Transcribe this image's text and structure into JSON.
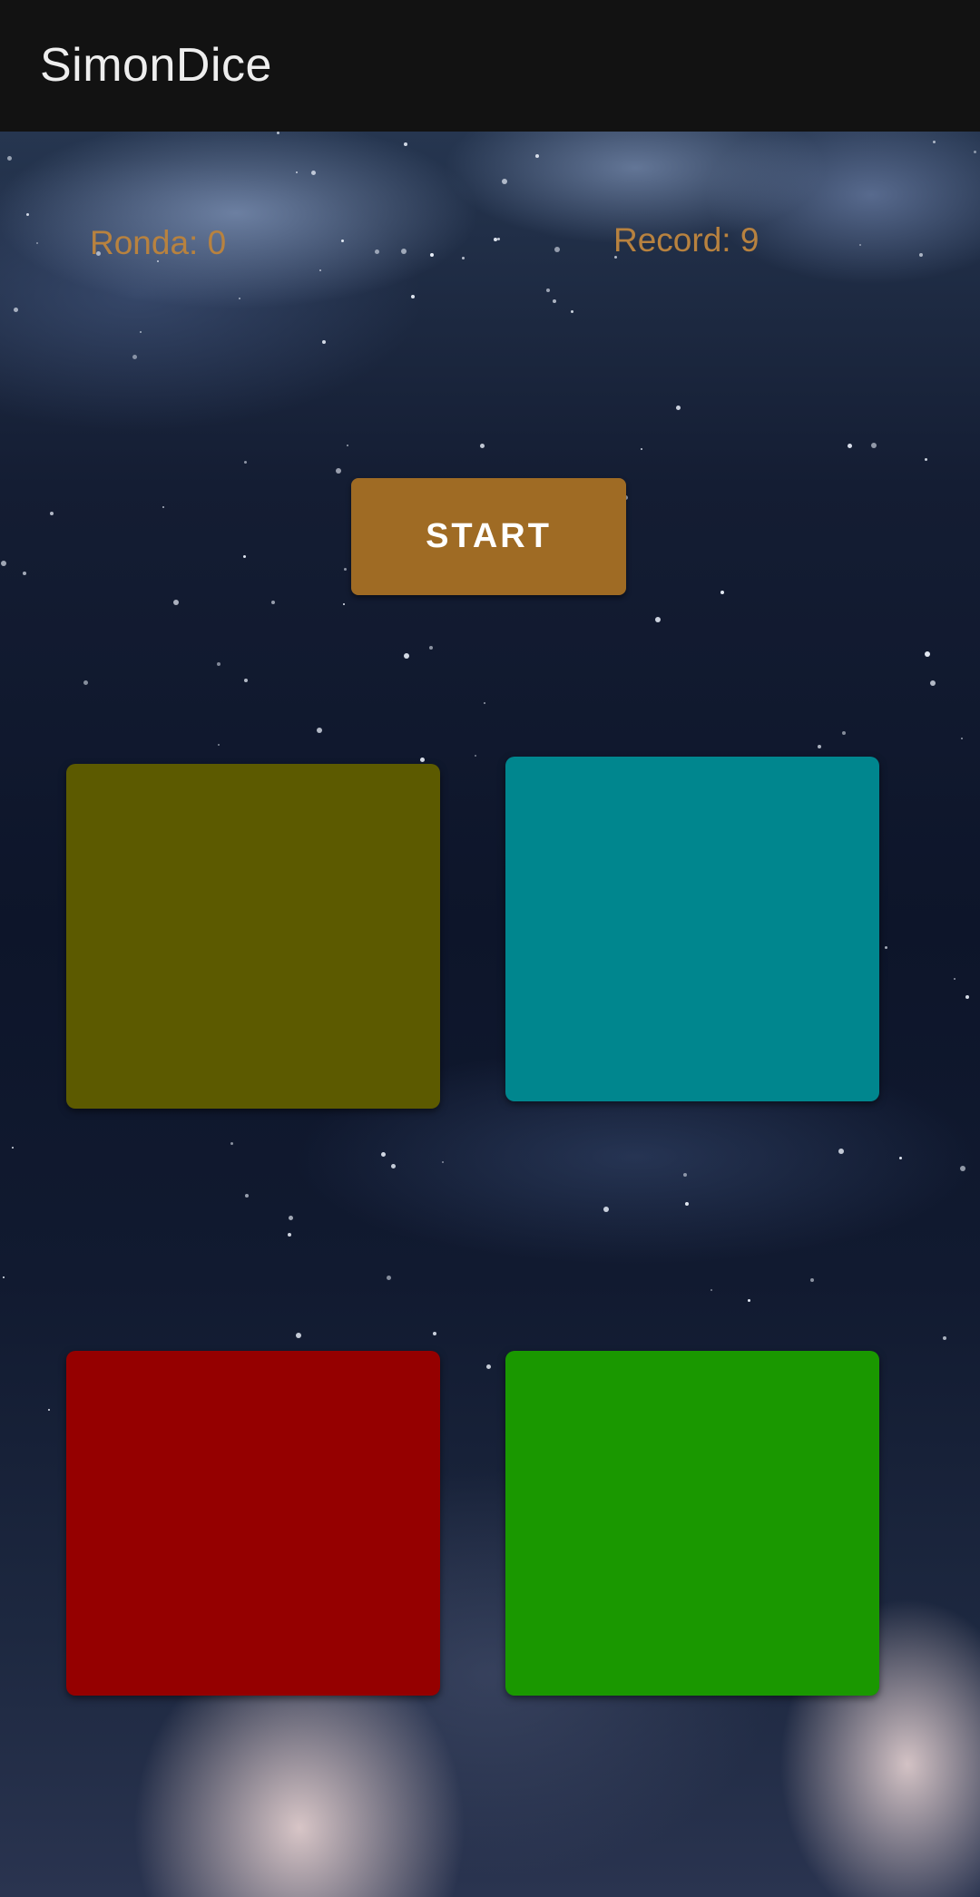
{
  "app_bar": {
    "title": "SimonDice"
  },
  "scores": {
    "ronda_text": "Ronda: 0",
    "record_text": "Record: 9"
  },
  "start_button": {
    "label": "START"
  },
  "pads": [
    {
      "name": "yellow",
      "color": "#5c5a00"
    },
    {
      "name": "blue",
      "color": "#00868e"
    },
    {
      "name": "red",
      "color": "#950000"
    },
    {
      "name": "green",
      "color": "#1a9800"
    }
  ],
  "colors": {
    "score_text": "#b8823f",
    "start_button_bg": "#9f6b24",
    "app_bar_bg": "#121212"
  }
}
